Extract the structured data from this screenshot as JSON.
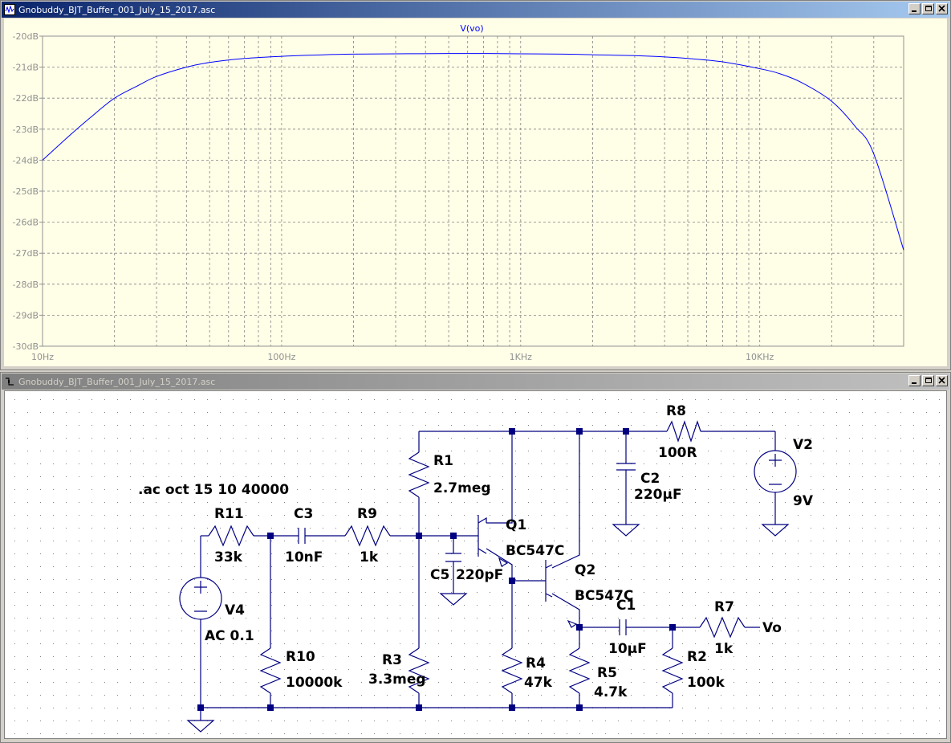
{
  "plot_window": {
    "title": "Gnobuddy_BJT_Buffer_001_July_15_2017.asc",
    "trace_label": "V(vo)",
    "trace_color": "#0000ff"
  },
  "schematic_window": {
    "title": "Gnobuddy_BJT_Buffer_001_July_15_2017.asc",
    "directive": ".ac oct 15 10 40000",
    "components": {
      "R11": {
        "name": "R11",
        "value": "33k"
      },
      "C3": {
        "name": "C3",
        "value": "10nF"
      },
      "R9": {
        "name": "R9",
        "value": "1k"
      },
      "R1": {
        "name": "R1",
        "value": "2.7meg"
      },
      "C5": {
        "name": "C5",
        "value": "220pF"
      },
      "Q1": {
        "name": "Q1",
        "value": "BC547C"
      },
      "Q2": {
        "name": "Q2",
        "value": "BC547C"
      },
      "R8": {
        "name": "R8",
        "value": "100R"
      },
      "C2": {
        "name": "C2",
        "value": "220µF"
      },
      "V2": {
        "name": "V2",
        "value": "9V"
      },
      "V4": {
        "name": "V4",
        "value": "AC 0.1"
      },
      "R10": {
        "name": "R10",
        "value": "10000k"
      },
      "R3": {
        "name": "R3",
        "value": "3.3meg"
      },
      "R4": {
        "name": "R4",
        "value": "47k"
      },
      "R5": {
        "name": "R5",
        "value": "4.7k"
      },
      "C1": {
        "name": "C1",
        "value": "10µF"
      },
      "R2": {
        "name": "R2",
        "value": "100k"
      },
      "R7": {
        "name": "R7",
        "value": "1k"
      },
      "Vo": {
        "name": "Vo"
      }
    }
  },
  "chart_data": {
    "type": "line",
    "title": "V(vo)",
    "x_scale": "log",
    "xlim": [
      10,
      40000
    ],
    "ylim": [
      -30,
      -20
    ],
    "x_tick_labels": [
      "10Hz",
      "100Hz",
      "1KHz",
      "10KHz"
    ],
    "y_tick_labels": [
      "-20dB",
      "-21dB",
      "-22dB",
      "-23dB",
      "-24dB",
      "-25dB",
      "-26dB",
      "-27dB",
      "-28dB",
      "-29dB",
      "-30dB"
    ],
    "grid": true,
    "series": [
      {
        "name": "V(vo)",
        "x": [
          10,
          13,
          16,
          20,
          25,
          30,
          40,
          50,
          70,
          100,
          150,
          200,
          300,
          500,
          700,
          1000,
          1500,
          2000,
          3000,
          4000,
          5000,
          7000,
          10000,
          12000,
          15000,
          20000,
          25000,
          30000,
          40000
        ],
        "y": [
          -24.0,
          -23.2,
          -22.6,
          -22.0,
          -21.6,
          -21.3,
          -21.0,
          -20.85,
          -20.72,
          -20.65,
          -20.6,
          -20.58,
          -20.57,
          -20.56,
          -20.56,
          -20.57,
          -20.58,
          -20.6,
          -20.63,
          -20.67,
          -20.72,
          -20.83,
          -21.05,
          -21.2,
          -21.5,
          -22.1,
          -22.9,
          -23.8,
          -26.9
        ]
      }
    ]
  }
}
